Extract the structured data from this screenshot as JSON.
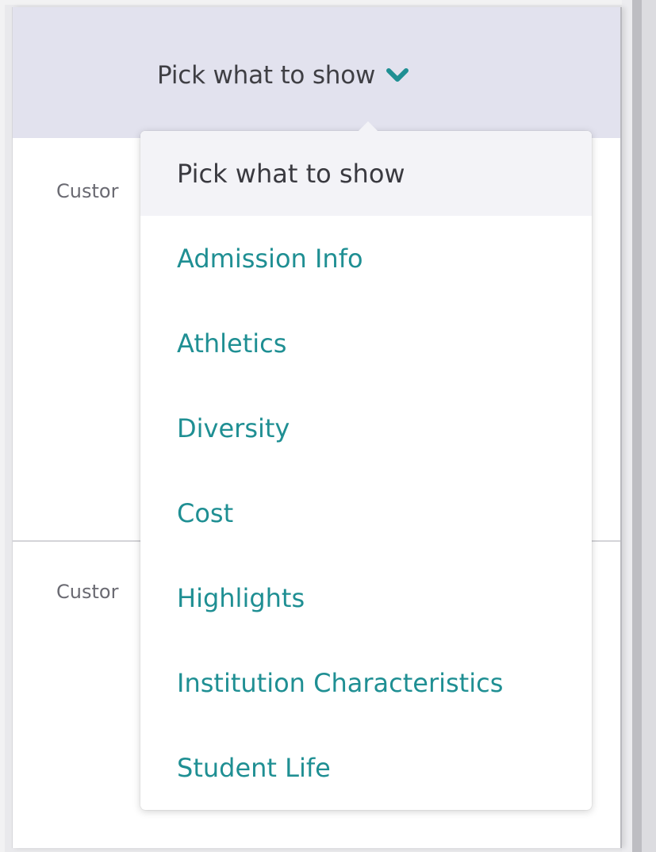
{
  "picker": {
    "trigger_label": "Pick what to show",
    "chevron_icon": "chevron-down-icon",
    "accent_color": "#1f8f93"
  },
  "rows": {
    "first_label": "Custor",
    "second_label": "Custor"
  },
  "dropdown": {
    "selected_label": "Pick what to show",
    "items": [
      {
        "label": "Pick what to show"
      },
      {
        "label": "Admission Info"
      },
      {
        "label": "Athletics"
      },
      {
        "label": "Diversity"
      },
      {
        "label": "Cost"
      },
      {
        "label": "Highlights"
      },
      {
        "label": "Institution Characteristics"
      },
      {
        "label": "Student Life"
      }
    ]
  }
}
